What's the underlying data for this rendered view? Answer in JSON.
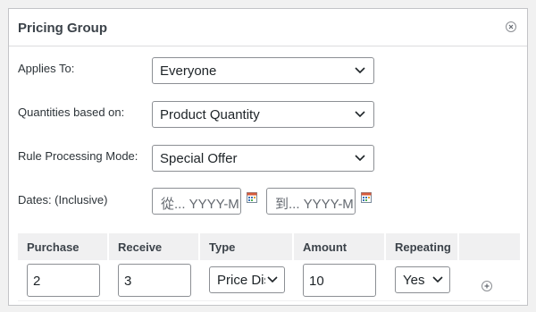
{
  "panel": {
    "title": "Pricing Group",
    "close_icon": "close-circle-icon"
  },
  "fields": {
    "applies_to": {
      "label": "Applies To:",
      "value": "Everyone"
    },
    "quantities": {
      "label": "Quantities based on:",
      "value": "Product Quantity"
    },
    "mode": {
      "label": "Rule Processing Mode:",
      "value": "Special Offer"
    },
    "dates": {
      "label": "Dates: (Inclusive)",
      "from_placeholder": "從... YYYY-MM-DD",
      "to_placeholder": "到... YYYY-MM-DD",
      "calendar_icon": "calendar-icon"
    }
  },
  "table": {
    "headers": [
      "Purchase",
      "Receive",
      "Type",
      "Amount",
      "Repeating"
    ],
    "row": {
      "purchase": "2",
      "receive": "3",
      "type": "Price Discount",
      "amount": "10",
      "repeating": "Yes",
      "add_icon": "add-circle-icon"
    }
  },
  "colors": {
    "border": "#8c8f94",
    "header_bg": "#f0f0f1",
    "page_bg": "#f1f1f1"
  }
}
